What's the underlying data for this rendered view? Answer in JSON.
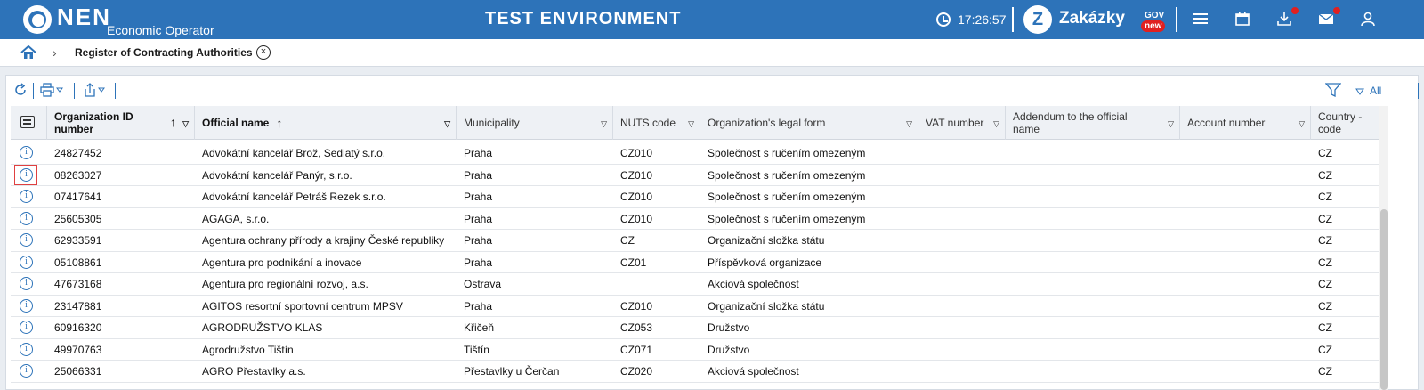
{
  "header": {
    "logo": "NEN",
    "logo_sub": "Economic Operator",
    "env_title": "TEST ENVIRONMENT",
    "clock": "17:26:57",
    "zakazky": "Zakázky",
    "zakazky_gov": "GOV",
    "zakazky_new": "new",
    "icons": [
      "menu-icon",
      "calendar-icon",
      "download-icon",
      "mail-icon",
      "user-icon"
    ]
  },
  "breadcrumb": {
    "current": "Register of Contracting Authorities"
  },
  "toolbar": {
    "filter_all": "All"
  },
  "table": {
    "columns": [
      "Organization ID number",
      "Official name",
      "Municipality",
      "NUTS code",
      "Organization's legal form",
      "VAT number",
      "Addendum to the official name",
      "Account number",
      "Country - code"
    ],
    "rows": [
      {
        "id": "24827452",
        "name": "Advokátní kancelář Brož, Sedlatý s.r.o.",
        "municipality": "Praha",
        "nuts": "CZ010",
        "legal": "Společnost s ručením omezeným",
        "country": "CZ"
      },
      {
        "id": "08263027",
        "name": "Advokátní kancelář Panýr, s.r.o.",
        "municipality": "Praha",
        "nuts": "CZ010",
        "legal": "Společnost s ručením omezeným",
        "country": "CZ"
      },
      {
        "id": "07417641",
        "name": "Advokátní kancelář Petráš Rezek s.r.o.",
        "municipality": "Praha",
        "nuts": "CZ010",
        "legal": "Společnost s ručením omezeným",
        "country": "CZ"
      },
      {
        "id": "25605305",
        "name": "AGAGA, s.r.o.",
        "municipality": "Praha",
        "nuts": "CZ010",
        "legal": "Společnost s ručením omezeným",
        "country": "CZ"
      },
      {
        "id": "62933591",
        "name": "Agentura ochrany přírody a krajiny České republiky",
        "municipality": "Praha",
        "nuts": "CZ",
        "legal": "Organizační složka státu",
        "country": "CZ"
      },
      {
        "id": "05108861",
        "name": "Agentura pro podnikání a inovace",
        "municipality": "Praha",
        "nuts": "CZ01",
        "legal": "Příspěvková organizace",
        "country": "CZ"
      },
      {
        "id": "47673168",
        "name": "Agentura pro regionální rozvoj, a.s.",
        "municipality": "Ostrava",
        "nuts": "",
        "legal": "Akciová společnost",
        "country": "CZ"
      },
      {
        "id": "23147881",
        "name": "AGITOS resortní sportovní centrum MPSV",
        "municipality": "Praha",
        "nuts": "CZ010",
        "legal": "Organizační složka státu",
        "country": "CZ"
      },
      {
        "id": "60916320",
        "name": "AGRODRUŽSTVO KLAS",
        "municipality": "Křičeň",
        "nuts": "CZ053",
        "legal": "Družstvo",
        "country": "CZ"
      },
      {
        "id": "49970763",
        "name": "Agrodružstvo Tištín",
        "municipality": "Tištín",
        "nuts": "CZ071",
        "legal": "Družstvo",
        "country": "CZ"
      },
      {
        "id": "25066331",
        "name": "AGRO Přestavlky a.s.",
        "municipality": "Přestavlky u Čerčan",
        "nuts": "CZ020",
        "legal": "Akciová společnost",
        "country": "CZ"
      }
    ]
  }
}
